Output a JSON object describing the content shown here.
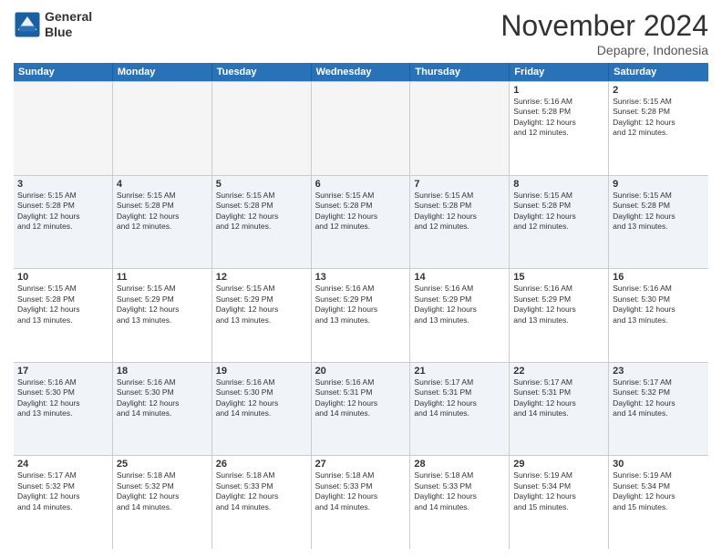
{
  "logo": {
    "line1": "General",
    "line2": "Blue"
  },
  "title": "November 2024",
  "location": "Depapre, Indonesia",
  "weekdays": [
    "Sunday",
    "Monday",
    "Tuesday",
    "Wednesday",
    "Thursday",
    "Friday",
    "Saturday"
  ],
  "rows": [
    [
      {
        "day": "",
        "lines": []
      },
      {
        "day": "",
        "lines": []
      },
      {
        "day": "",
        "lines": []
      },
      {
        "day": "",
        "lines": []
      },
      {
        "day": "",
        "lines": []
      },
      {
        "day": "1",
        "lines": [
          "Sunrise: 5:16 AM",
          "Sunset: 5:28 PM",
          "Daylight: 12 hours",
          "and 12 minutes."
        ]
      },
      {
        "day": "2",
        "lines": [
          "Sunrise: 5:15 AM",
          "Sunset: 5:28 PM",
          "Daylight: 12 hours",
          "and 12 minutes."
        ]
      }
    ],
    [
      {
        "day": "3",
        "lines": [
          "Sunrise: 5:15 AM",
          "Sunset: 5:28 PM",
          "Daylight: 12 hours",
          "and 12 minutes."
        ]
      },
      {
        "day": "4",
        "lines": [
          "Sunrise: 5:15 AM",
          "Sunset: 5:28 PM",
          "Daylight: 12 hours",
          "and 12 minutes."
        ]
      },
      {
        "day": "5",
        "lines": [
          "Sunrise: 5:15 AM",
          "Sunset: 5:28 PM",
          "Daylight: 12 hours",
          "and 12 minutes."
        ]
      },
      {
        "day": "6",
        "lines": [
          "Sunrise: 5:15 AM",
          "Sunset: 5:28 PM",
          "Daylight: 12 hours",
          "and 12 minutes."
        ]
      },
      {
        "day": "7",
        "lines": [
          "Sunrise: 5:15 AM",
          "Sunset: 5:28 PM",
          "Daylight: 12 hours",
          "and 12 minutes."
        ]
      },
      {
        "day": "8",
        "lines": [
          "Sunrise: 5:15 AM",
          "Sunset: 5:28 PM",
          "Daylight: 12 hours",
          "and 12 minutes."
        ]
      },
      {
        "day": "9",
        "lines": [
          "Sunrise: 5:15 AM",
          "Sunset: 5:28 PM",
          "Daylight: 12 hours",
          "and 13 minutes."
        ]
      }
    ],
    [
      {
        "day": "10",
        "lines": [
          "Sunrise: 5:15 AM",
          "Sunset: 5:28 PM",
          "Daylight: 12 hours",
          "and 13 minutes."
        ]
      },
      {
        "day": "11",
        "lines": [
          "Sunrise: 5:15 AM",
          "Sunset: 5:29 PM",
          "Daylight: 12 hours",
          "and 13 minutes."
        ]
      },
      {
        "day": "12",
        "lines": [
          "Sunrise: 5:15 AM",
          "Sunset: 5:29 PM",
          "Daylight: 12 hours",
          "and 13 minutes."
        ]
      },
      {
        "day": "13",
        "lines": [
          "Sunrise: 5:16 AM",
          "Sunset: 5:29 PM",
          "Daylight: 12 hours",
          "and 13 minutes."
        ]
      },
      {
        "day": "14",
        "lines": [
          "Sunrise: 5:16 AM",
          "Sunset: 5:29 PM",
          "Daylight: 12 hours",
          "and 13 minutes."
        ]
      },
      {
        "day": "15",
        "lines": [
          "Sunrise: 5:16 AM",
          "Sunset: 5:29 PM",
          "Daylight: 12 hours",
          "and 13 minutes."
        ]
      },
      {
        "day": "16",
        "lines": [
          "Sunrise: 5:16 AM",
          "Sunset: 5:30 PM",
          "Daylight: 12 hours",
          "and 13 minutes."
        ]
      }
    ],
    [
      {
        "day": "17",
        "lines": [
          "Sunrise: 5:16 AM",
          "Sunset: 5:30 PM",
          "Daylight: 12 hours",
          "and 13 minutes."
        ]
      },
      {
        "day": "18",
        "lines": [
          "Sunrise: 5:16 AM",
          "Sunset: 5:30 PM",
          "Daylight: 12 hours",
          "and 14 minutes."
        ]
      },
      {
        "day": "19",
        "lines": [
          "Sunrise: 5:16 AM",
          "Sunset: 5:30 PM",
          "Daylight: 12 hours",
          "and 14 minutes."
        ]
      },
      {
        "day": "20",
        "lines": [
          "Sunrise: 5:16 AM",
          "Sunset: 5:31 PM",
          "Daylight: 12 hours",
          "and 14 minutes."
        ]
      },
      {
        "day": "21",
        "lines": [
          "Sunrise: 5:17 AM",
          "Sunset: 5:31 PM",
          "Daylight: 12 hours",
          "and 14 minutes."
        ]
      },
      {
        "day": "22",
        "lines": [
          "Sunrise: 5:17 AM",
          "Sunset: 5:31 PM",
          "Daylight: 12 hours",
          "and 14 minutes."
        ]
      },
      {
        "day": "23",
        "lines": [
          "Sunrise: 5:17 AM",
          "Sunset: 5:32 PM",
          "Daylight: 12 hours",
          "and 14 minutes."
        ]
      }
    ],
    [
      {
        "day": "24",
        "lines": [
          "Sunrise: 5:17 AM",
          "Sunset: 5:32 PM",
          "Daylight: 12 hours",
          "and 14 minutes."
        ]
      },
      {
        "day": "25",
        "lines": [
          "Sunrise: 5:18 AM",
          "Sunset: 5:32 PM",
          "Daylight: 12 hours",
          "and 14 minutes."
        ]
      },
      {
        "day": "26",
        "lines": [
          "Sunrise: 5:18 AM",
          "Sunset: 5:33 PM",
          "Daylight: 12 hours",
          "and 14 minutes."
        ]
      },
      {
        "day": "27",
        "lines": [
          "Sunrise: 5:18 AM",
          "Sunset: 5:33 PM",
          "Daylight: 12 hours",
          "and 14 minutes."
        ]
      },
      {
        "day": "28",
        "lines": [
          "Sunrise: 5:18 AM",
          "Sunset: 5:33 PM",
          "Daylight: 12 hours",
          "and 14 minutes."
        ]
      },
      {
        "day": "29",
        "lines": [
          "Sunrise: 5:19 AM",
          "Sunset: 5:34 PM",
          "Daylight: 12 hours",
          "and 15 minutes."
        ]
      },
      {
        "day": "30",
        "lines": [
          "Sunrise: 5:19 AM",
          "Sunset: 5:34 PM",
          "Daylight: 12 hours",
          "and 15 minutes."
        ]
      }
    ]
  ]
}
